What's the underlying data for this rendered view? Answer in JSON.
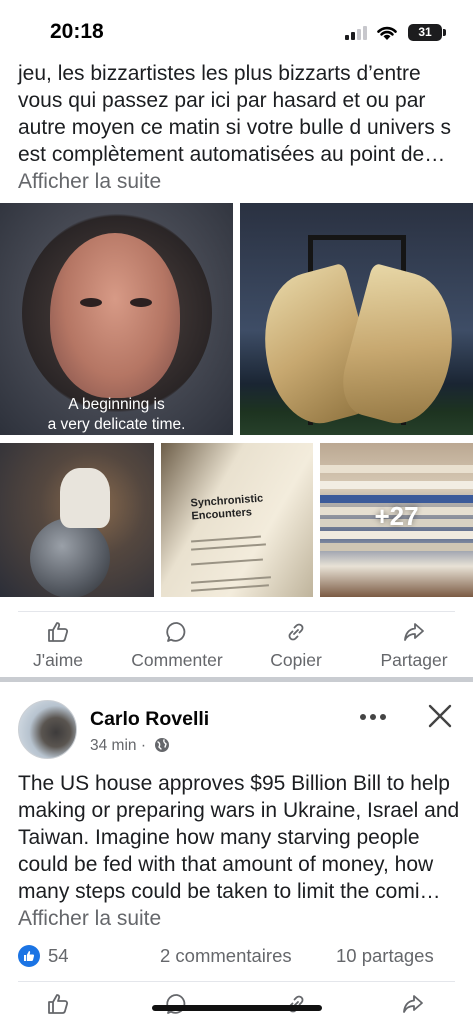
{
  "status_bar": {
    "time": "20:18",
    "battery": "31"
  },
  "post1": {
    "text": "jeu, les bizzartistes les plus bizzarts d’entre vous qui passez  par ici par hasard et ou par autre moyen ce matin si votre bulle d univers s est complètement automatisées au point de… ",
    "see_more": "Afficher la suite",
    "gallery": {
      "caption_line1": "A beginning is",
      "caption_line2": "a very delicate time.",
      "book_title_line1": "Synchronistic",
      "book_title_line2": "Encounters",
      "more_count": "+27"
    },
    "actions": {
      "like": "J'aime",
      "comment": "Commenter",
      "copy": "Copier",
      "share": "Partager"
    }
  },
  "post2": {
    "author": "Carlo Rovelli",
    "time": "34 min",
    "separator": "·",
    "text": "The US house approves $95 Billion Bill to help making or preparing wars in Ukraine, Israel and Taiwan.  Imagine how many starving people could be fed with that amount of money, how many steps could be taken to limit the comi… ",
    "see_more": "Afficher la suite",
    "reactions": {
      "likes": "54",
      "comments": "2 commentaires",
      "shares": "10 partages"
    }
  },
  "colors": {
    "accent_blue": "#1b74e4",
    "muted_text": "#65676b",
    "divider": "#e4e6eb"
  }
}
